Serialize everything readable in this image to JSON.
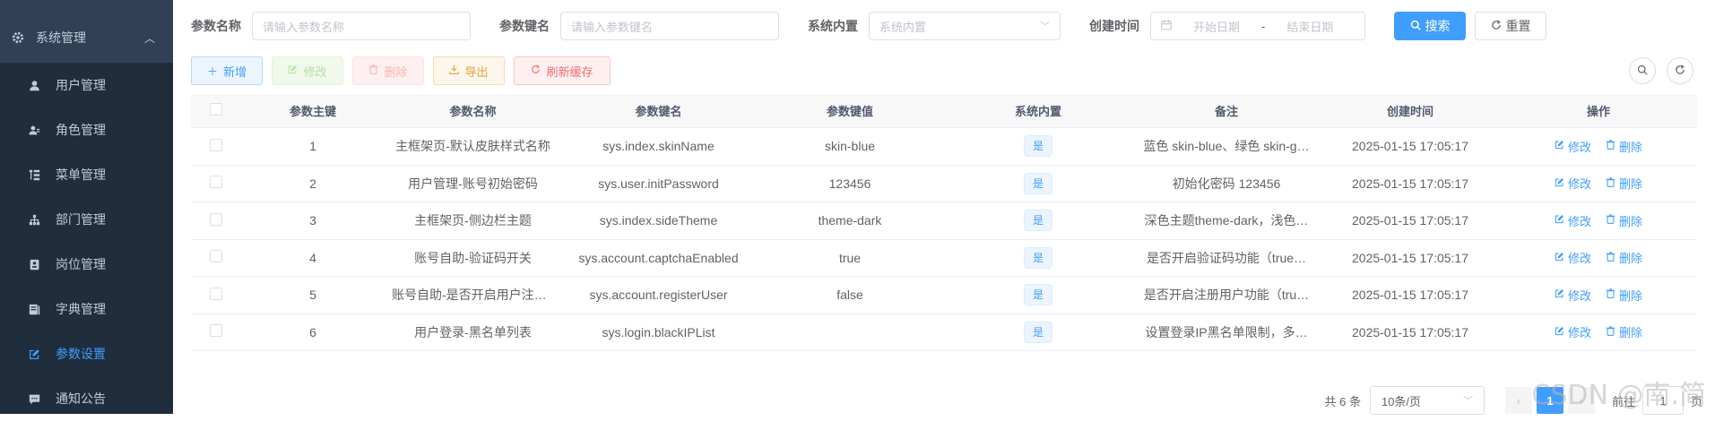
{
  "sidebar": {
    "parent": {
      "label": "系统管理",
      "icon": "gear-icon"
    },
    "items": [
      {
        "label": "用户管理",
        "icon": "user-icon",
        "active": false
      },
      {
        "label": "角色管理",
        "icon": "role-icon",
        "active": false
      },
      {
        "label": "菜单管理",
        "icon": "tree-table-icon",
        "active": false
      },
      {
        "label": "部门管理",
        "icon": "org-tree-icon",
        "active": false
      },
      {
        "label": "岗位管理",
        "icon": "post-icon",
        "active": false
      },
      {
        "label": "字典管理",
        "icon": "dict-icon",
        "active": false
      },
      {
        "label": "参数设置",
        "icon": "edit-icon",
        "active": true
      },
      {
        "label": "通知公告",
        "icon": "message-icon",
        "active": false
      }
    ]
  },
  "search": {
    "name_label": "参数名称",
    "name_placeholder": "请输入参数名称",
    "key_label": "参数键名",
    "key_placeholder": "请输入参数键名",
    "type_label": "系统内置",
    "type_placeholder": "系统内置",
    "time_label": "创建时间",
    "start_placeholder": "开始日期",
    "range_sep": "-",
    "end_placeholder": "结束日期",
    "search_btn": "搜索",
    "reset_btn": "重置"
  },
  "toolbar": {
    "add": "新增",
    "edit": "修改",
    "delete": "删除",
    "export": "导出",
    "refresh_cache": "刷新缓存"
  },
  "table": {
    "headers": [
      "参数主键",
      "参数名称",
      "参数键名",
      "参数键值",
      "系统内置",
      "备注",
      "创建时间",
      "操作"
    ],
    "edit_label": "修改",
    "delete_label": "删除",
    "rows": [
      {
        "id": "1",
        "name": "主框架页-默认皮肤样式名称",
        "key": "sys.index.skinName",
        "value": "skin-blue",
        "builtin": "是",
        "remark": "蓝色 skin-blue、绿色 skin-g…",
        "time": "2025-01-15 17:05:17"
      },
      {
        "id": "2",
        "name": "用户管理-账号初始密码",
        "key": "sys.user.initPassword",
        "value": "123456",
        "builtin": "是",
        "remark": "初始化密码 123456",
        "time": "2025-01-15 17:05:17"
      },
      {
        "id": "3",
        "name": "主框架页-侧边栏主题",
        "key": "sys.index.sideTheme",
        "value": "theme-dark",
        "builtin": "是",
        "remark": "深色主题theme-dark，浅色…",
        "time": "2025-01-15 17:05:17"
      },
      {
        "id": "4",
        "name": "账号自助-验证码开关",
        "key": "sys.account.captchaEnabled",
        "value": "true",
        "builtin": "是",
        "remark": "是否开启验证码功能（true…",
        "time": "2025-01-15 17:05:17"
      },
      {
        "id": "5",
        "name": "账号自助-是否开启用户注册…",
        "key": "sys.account.registerUser",
        "value": "false",
        "builtin": "是",
        "remark": "是否开启注册用户功能（tru…",
        "time": "2025-01-15 17:05:17"
      },
      {
        "id": "6",
        "name": "用户登录-黑名单列表",
        "key": "sys.login.blackIPList",
        "value": "",
        "builtin": "是",
        "remark": "设置登录IP黑名单限制，多…",
        "time": "2025-01-15 17:05:17"
      }
    ]
  },
  "pagination": {
    "total": "共 6 条",
    "page_size": "10条/页",
    "current": "1",
    "goto": "前往",
    "jump_value": "1",
    "page_unit": "页"
  },
  "watermark": "CSDN @南.简"
}
